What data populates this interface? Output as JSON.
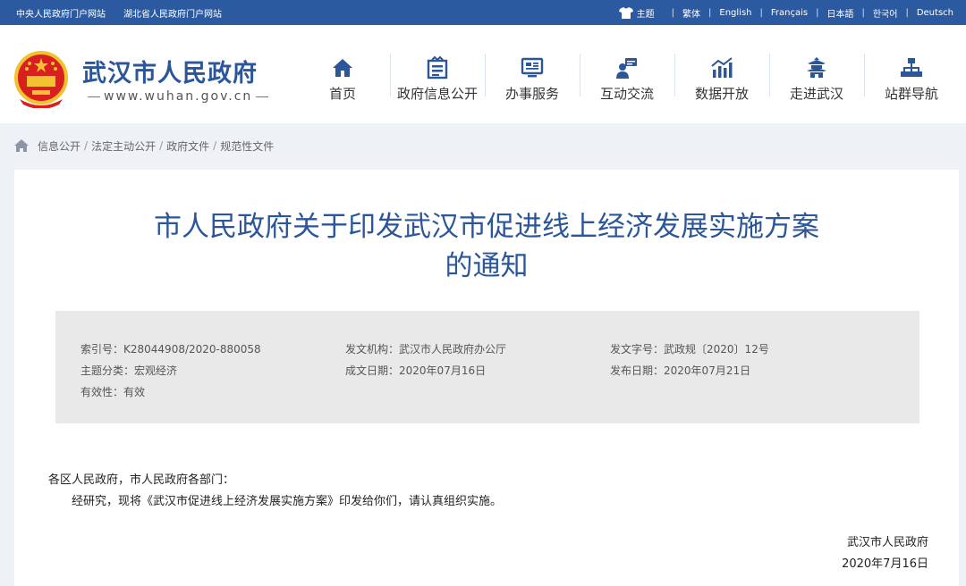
{
  "topbar": {
    "left_links": [
      "中央人民政府门户网站",
      "湖北省人民政府门户网站"
    ],
    "theme_label": "主题",
    "languages": [
      "繁体",
      "English",
      "Français",
      "日本語",
      "한국어",
      "Deutsch"
    ]
  },
  "header": {
    "site_name": "武汉市人民政府",
    "site_url": "www.wuhan.gov.cn",
    "nav": [
      {
        "label": "首页",
        "icon": "home-icon"
      },
      {
        "label": "政府信息公开",
        "icon": "document-icon"
      },
      {
        "label": "办事服务",
        "icon": "monitor-icon"
      },
      {
        "label": "互动交流",
        "icon": "chat-icon"
      },
      {
        "label": "数据开放",
        "icon": "chart-icon"
      },
      {
        "label": "走进武汉",
        "icon": "pavilion-icon"
      },
      {
        "label": "站群导航",
        "icon": "sitemap-icon"
      }
    ]
  },
  "breadcrumb": [
    "信息公开",
    "法定主动公开",
    "政府文件",
    "规范性文件"
  ],
  "document": {
    "title_line1": "市人民政府关于印发武汉市促进线上经济发展实施方案",
    "title_line2": "的通知",
    "meta": {
      "index_no_label": "索引号：",
      "index_no": "K28044908/2020-880058",
      "issuer_label": "发文机构：",
      "issuer": "武汉市人民政府办公厅",
      "doc_no_label": "发文字号：",
      "doc_no": "武政规〔2020〕12号",
      "category_label": "主题分类：",
      "category": "宏观经济",
      "written_date_label": "成文日期：",
      "written_date": "2020年07月16日",
      "publish_date_label": "发布日期：",
      "publish_date": "2020年07月21日",
      "validity_label": "有效性：",
      "validity": "有效"
    },
    "salutation": "各区人民政府，市人民政府各部门：",
    "body": "经研究，现将《武汉市促进线上经济发展实施方案》印发给你们，请认真组织实施。",
    "signature": "武汉市人民政府",
    "sign_date": "2020年7月16日"
  },
  "colors": {
    "brand_blue": "#2c5aa0",
    "title_blue": "#2b5699",
    "emblem_red": "#d8201e",
    "emblem_gold": "#f2c230"
  }
}
